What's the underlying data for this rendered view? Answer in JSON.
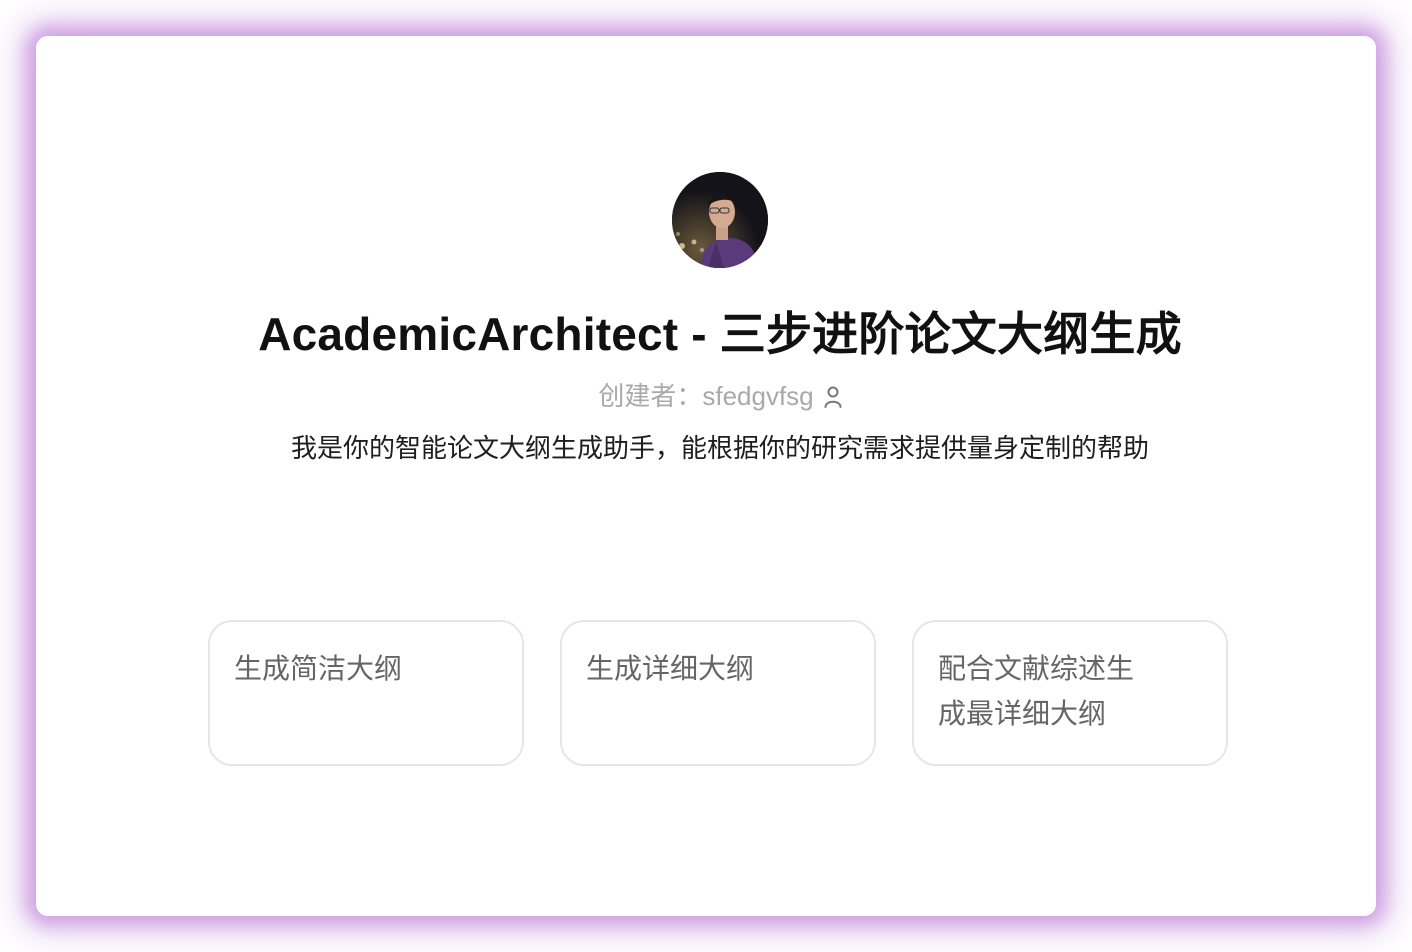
{
  "app": {
    "title": "AcademicArchitect - 三步进阶论文大纲生成",
    "creator_label": "创建者：",
    "creator_name": "sfedgvfsg",
    "description": "我是你的智能论文大纲生成助手，能根据你的研究需求提供量身定制的帮助"
  },
  "suggestions": [
    {
      "label": "生成简洁大纲"
    },
    {
      "label": "生成详细大纲"
    },
    {
      "label": "配合文献综述生成最详细大纲"
    }
  ],
  "colors": {
    "glow": "#c88fdc",
    "title": "#111111",
    "creator": "#a9a9a9",
    "suggestion_text": "#666666",
    "suggestion_border": "#e6e6e6"
  },
  "icons": {
    "avatar": "avatar-photo",
    "creator": "person-icon"
  }
}
